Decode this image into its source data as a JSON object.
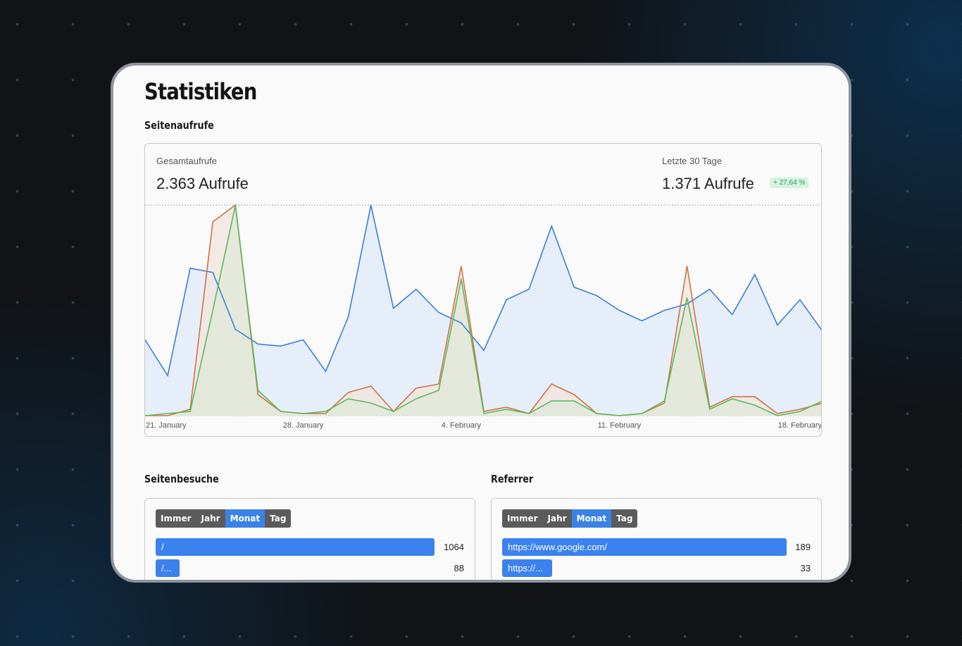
{
  "page": {
    "title": "Statistiken"
  },
  "pageviews": {
    "section_title": "Seitenaufrufe",
    "total_label": "Gesamtaufrufe",
    "total_value": "2.363 Aufrufe",
    "recent_label": "Letzte 30 Tage",
    "recent_value": "1.371 Aufrufe",
    "recent_change": "+ 27,64 %"
  },
  "chart_data": {
    "type": "area",
    "title": "",
    "xlabel": "",
    "ylabel": "",
    "x_ticks": [
      "21. January",
      "28. January",
      "4. February",
      "11. February",
      "18. February"
    ],
    "x_range": [
      1,
      31
    ],
    "ylim": [
      0,
      100
    ],
    "grid": false,
    "legend": "none",
    "series": [
      {
        "color": "#3a7fd8",
        "fill": "#e6eef9",
        "values": [
          36,
          19,
          70,
          68,
          41,
          34,
          33,
          36,
          21,
          47,
          100,
          51,
          60,
          49,
          44,
          31,
          55,
          60,
          90,
          61,
          57,
          50,
          45,
          50,
          53,
          60,
          48,
          67,
          43,
          55,
          40
        ]
      },
      {
        "color": "#d07244",
        "fill": "#f2e4dc",
        "values": [
          0,
          0,
          3,
          92,
          100,
          10,
          2,
          1,
          1,
          11,
          14,
          2,
          13,
          15,
          71,
          2,
          4,
          1,
          15,
          10,
          1,
          0,
          1,
          6,
          71,
          4,
          9,
          9,
          1,
          3,
          6
        ]
      },
      {
        "color": "#5cb85c",
        "fill": "#dfe8d8",
        "values": [
          0,
          1,
          2,
          50,
          100,
          12,
          2,
          1,
          2,
          8,
          6,
          2,
          8,
          12,
          65,
          1,
          3,
          1,
          7,
          7,
          1,
          0,
          1,
          7,
          56,
          3,
          8,
          5,
          0,
          2,
          7
        ]
      }
    ]
  },
  "page_visits": {
    "section_title": "Seitenbesuche",
    "filters": [
      "Immer",
      "Jahr",
      "Monat",
      "Tag"
    ],
    "active_filter": "Monat",
    "rows": [
      {
        "label": "/",
        "count": "1064",
        "value": 1064
      },
      {
        "label": "/...",
        "count": "88",
        "value": 88
      }
    ]
  },
  "referrer": {
    "section_title": "Referrer",
    "filters": [
      "Immer",
      "Jahr",
      "Monat",
      "Tag"
    ],
    "active_filter": "Monat",
    "rows": [
      {
        "label": "https://www.google.com/",
        "count": "189",
        "value": 189
      },
      {
        "label": "https://...",
        "count": "33",
        "value": 33
      }
    ]
  },
  "colors": {
    "accent": "#3b82e6",
    "button_inactive": "#5b5b5b",
    "badge_green": "#2e9e55"
  }
}
